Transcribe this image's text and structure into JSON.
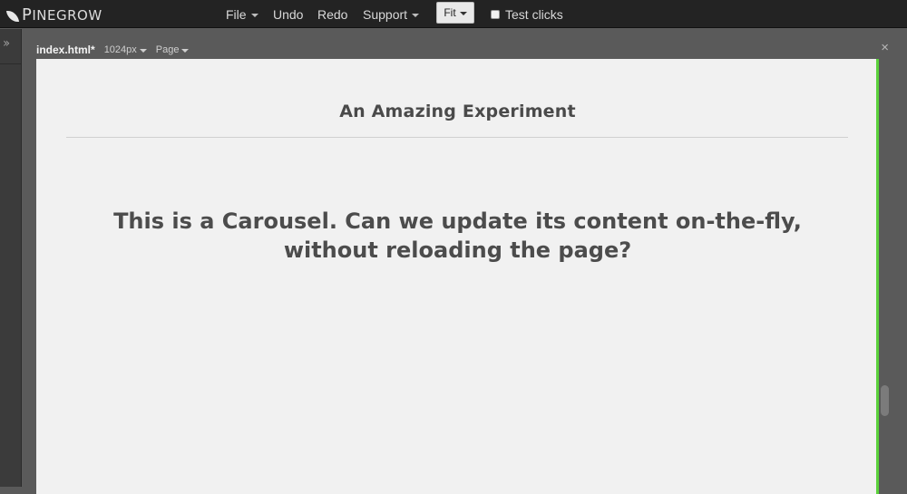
{
  "app": {
    "brand_initial": "P",
    "brand_rest": "INEGROW"
  },
  "menu": {
    "file": "File",
    "undo": "Undo",
    "redo": "Redo",
    "support": "Support",
    "fit": "Fit",
    "test_clicks": "Test clicks",
    "test_clicks_checked": false
  },
  "frame": {
    "filename": "index.html*",
    "width_label": "1024px",
    "page_label": "Page",
    "close": "×",
    "accent_color": "#5bd13b"
  },
  "page": {
    "heading": "An Amazing Experiment",
    "carousel_line1": "This is a Carousel. Can we update its content on-the-fly,",
    "carousel_line2": "without reloading the page?"
  },
  "icons": {
    "expand": "double-chevron-right-icon",
    "brand": "leaf-icon",
    "close": "close-icon"
  }
}
